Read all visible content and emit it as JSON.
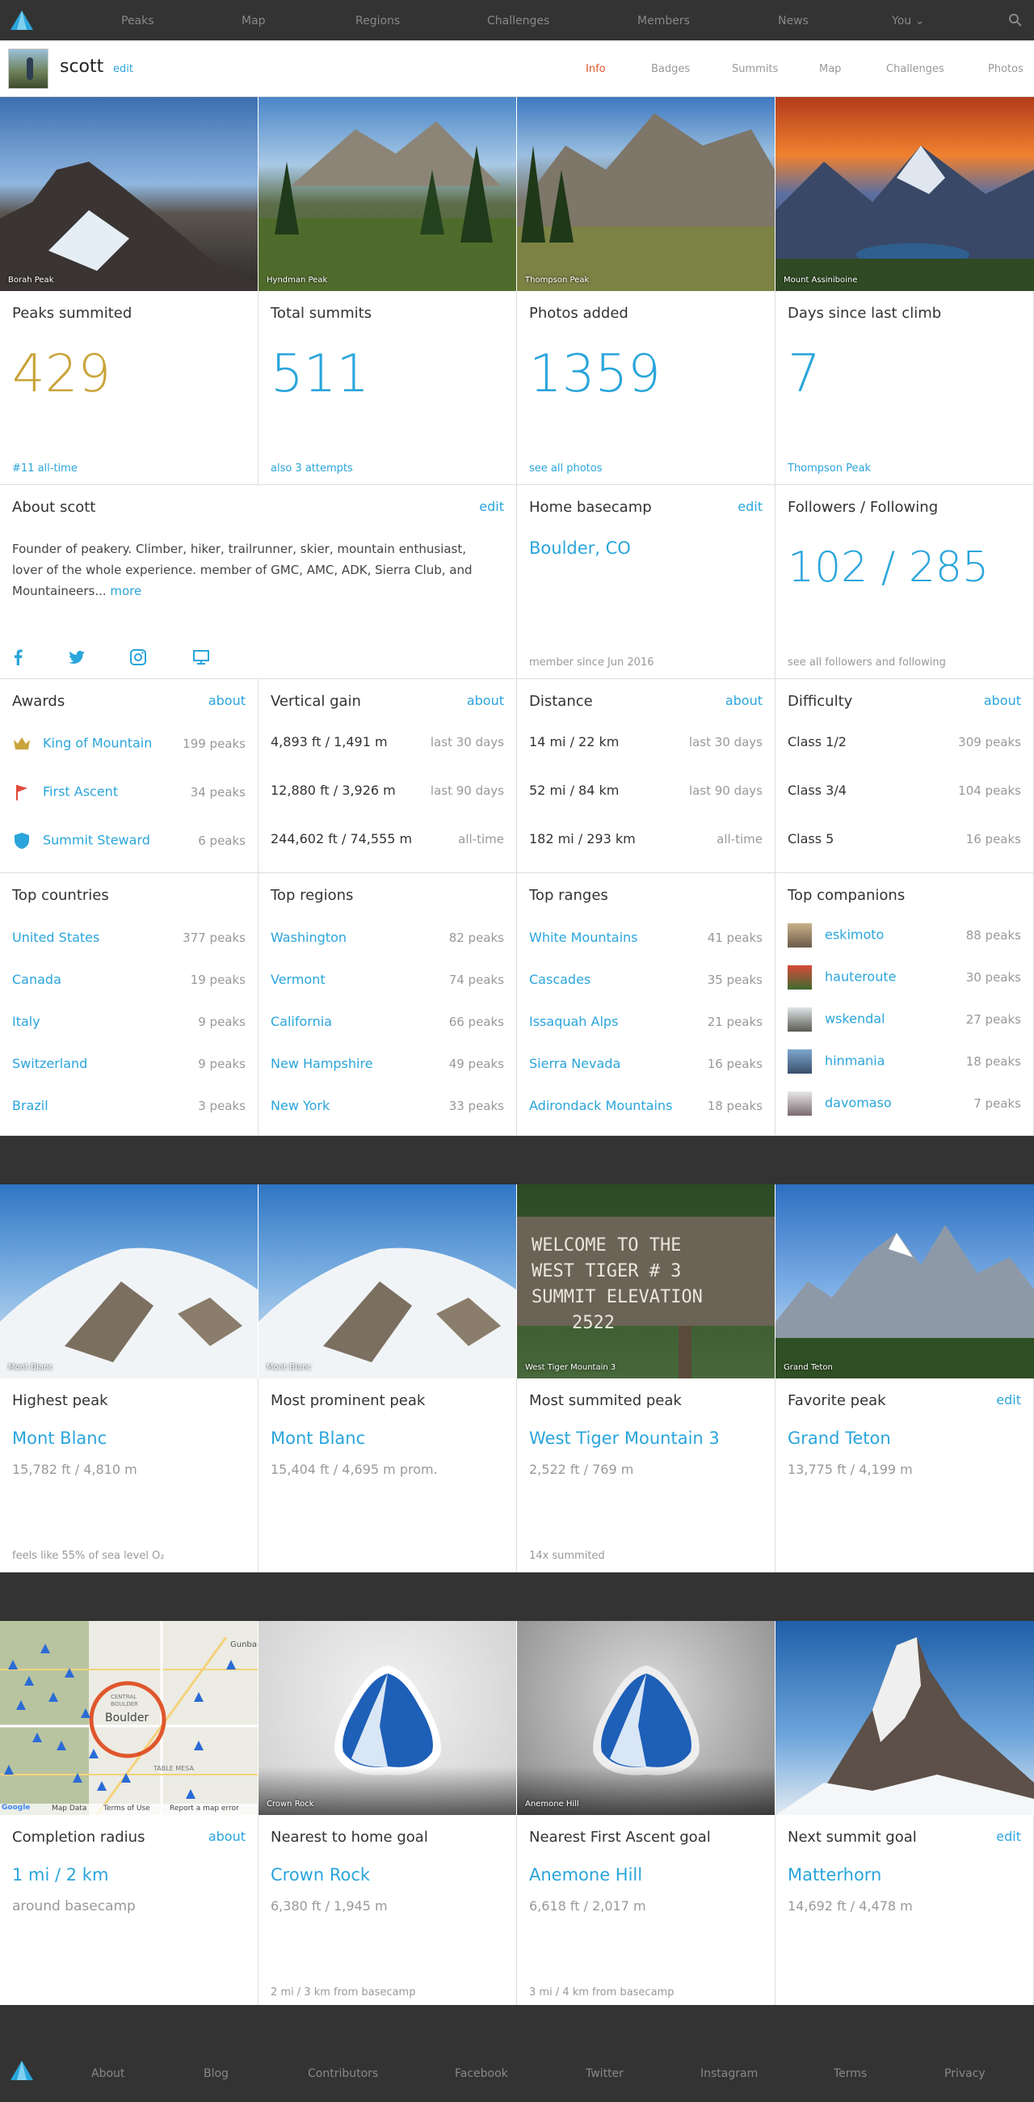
{
  "nav": {
    "items": [
      "Peaks",
      "Map",
      "Regions",
      "Challenges",
      "Members",
      "News",
      "You ⌄"
    ]
  },
  "profile": {
    "username": "scott",
    "edit": "edit",
    "tabs": [
      "Info",
      "Badges",
      "Summits",
      "Map",
      "Challenges",
      "Photos"
    ]
  },
  "photos_top": [
    "Borah Peak",
    "Hyndman Peak",
    "Thompson Peak",
    "Mount Assiniboine"
  ],
  "stats": [
    {
      "title": "Peaks summited",
      "value": "429",
      "foot": "#11 all-time",
      "color": "#c9a43a"
    },
    {
      "title": "Total summits",
      "value": "511",
      "foot": "also 3 attempts",
      "color": "#2aa5db"
    },
    {
      "title": "Photos added",
      "value": "1359",
      "foot": "see all photos",
      "color": "#2aa5db"
    },
    {
      "title": "Days since last climb",
      "value": "7",
      "foot": "Thompson Peak",
      "color": "#2aa5db"
    }
  ],
  "about": {
    "title": "About scott",
    "edit": "edit",
    "text": "Founder of peakery. Climber, hiker, trailrunner, skier, mountain enthusiast, lover of the whole experience. member of GMC, AMC, ADK, Sierra Club, and Mountaineers...",
    "more": "more"
  },
  "basecamp": {
    "title": "Home basecamp",
    "edit": "edit",
    "place": "Boulder, CO",
    "since": "member since Jun 2016"
  },
  "followers": {
    "title": "Followers / Following",
    "value": "102 / 285",
    "foot": "see all followers and following"
  },
  "awards": {
    "title": "Awards",
    "about": "about",
    "items": [
      {
        "name": "King of Mountain",
        "count": "199 peaks",
        "icon": "crown-icon"
      },
      {
        "name": "First Ascent",
        "count": "34 peaks",
        "icon": "flag-icon"
      },
      {
        "name": "Summit Steward",
        "count": "6 peaks",
        "icon": "shield-icon"
      }
    ]
  },
  "vertical": {
    "title": "Vertical gain",
    "about": "about",
    "items": [
      {
        "value": "4,893 ft / 1,491 m",
        "period": "last 30 days"
      },
      {
        "value": "12,880 ft / 3,926 m",
        "period": "last 90 days"
      },
      {
        "value": "244,602 ft / 74,555 m",
        "period": "all-time"
      }
    ]
  },
  "distance": {
    "title": "Distance",
    "about": "about",
    "items": [
      {
        "value": "14 mi / 22 km",
        "period": "last 30 days"
      },
      {
        "value": "52 mi / 84 km",
        "period": "last 90 days"
      },
      {
        "value": "182 mi / 293 km",
        "period": "all-time"
      }
    ]
  },
  "difficulty": {
    "title": "Difficulty",
    "about": "about",
    "items": [
      {
        "value": "Class 1/2",
        "count": "309 peaks"
      },
      {
        "value": "Class 3/4",
        "count": "104 peaks"
      },
      {
        "value": "Class 5",
        "count": "16 peaks"
      }
    ]
  },
  "countries": {
    "title": "Top countries",
    "items": [
      {
        "name": "United States",
        "count": "377 peaks"
      },
      {
        "name": "Canada",
        "count": "19 peaks"
      },
      {
        "name": "Italy",
        "count": "9 peaks"
      },
      {
        "name": "Switzerland",
        "count": "9 peaks"
      },
      {
        "name": "Brazil",
        "count": "3 peaks"
      }
    ]
  },
  "regions": {
    "title": "Top regions",
    "items": [
      {
        "name": "Washington",
        "count": "82 peaks"
      },
      {
        "name": "Vermont",
        "count": "74 peaks"
      },
      {
        "name": "California",
        "count": "66 peaks"
      },
      {
        "name": "New Hampshire",
        "count": "49 peaks"
      },
      {
        "name": "New York",
        "count": "33 peaks"
      }
    ]
  },
  "ranges": {
    "title": "Top ranges",
    "items": [
      {
        "name": "White Mountains",
        "count": "41 peaks"
      },
      {
        "name": "Cascades",
        "count": "35 peaks"
      },
      {
        "name": "Issaquah Alps",
        "count": "21 peaks"
      },
      {
        "name": "Sierra Nevada",
        "count": "16 peaks"
      },
      {
        "name": "Adirondack Mountains",
        "count": "18 peaks"
      }
    ]
  },
  "companions": {
    "title": "Top companions",
    "items": [
      {
        "name": "eskimoto",
        "count": "88 peaks"
      },
      {
        "name": "hauteroute",
        "count": "30 peaks"
      },
      {
        "name": "wskendal",
        "count": "27 peaks"
      },
      {
        "name": "hinmania",
        "count": "18 peaks"
      },
      {
        "name": "davomaso",
        "count": "7 peaks"
      }
    ]
  },
  "photos_mid": [
    "Mont Blanc",
    "Mont Blanc",
    "West Tiger Mountain 3",
    "Grand Teton"
  ],
  "sign_text": [
    "WELCOME TO THE",
    "WEST TIGER # 3",
    "SUMMIT ELEVATION",
    "2522"
  ],
  "peaks": [
    {
      "title": "Highest peak",
      "name": "Mont Blanc",
      "elev": "15,782 ft / 4,810 m",
      "foot": "feels like 55% of sea level O₂",
      "edit": ""
    },
    {
      "title": "Most prominent peak",
      "name": "Mont Blanc",
      "elev": "15,404 ft / 4,695 m prom.",
      "foot": "",
      "edit": ""
    },
    {
      "title": "Most summited peak",
      "name": "West Tiger Mountain 3",
      "elev": "2,522 ft / 769 m",
      "foot": "14x summited",
      "edit": ""
    },
    {
      "title": "Favorite peak",
      "name": "Grand Teton",
      "elev": "13,775 ft / 4,199 m",
      "foot": "",
      "edit": "edit"
    }
  ],
  "map": {
    "city": "Boulder",
    "labels": [
      "Gunbarrel",
      "CENTRAL BOULDER",
      "TABLE MESA",
      "Map Data",
      "Terms of Use",
      "Report a map error",
      "Google"
    ]
  },
  "photos_bot": [
    "",
    "Crown Rock",
    "Anemone Hill",
    ""
  ],
  "goals": [
    {
      "title": "Completion radius",
      "name": "1 mi / 2 km",
      "elev": "around basecamp",
      "foot": "",
      "edit": "about"
    },
    {
      "title": "Nearest to home goal",
      "name": "Crown Rock",
      "elev": "6,380 ft / 1,945 m",
      "foot": "2 mi / 3 km from basecamp",
      "edit": ""
    },
    {
      "title": "Nearest First Ascent goal",
      "name": "Anemone Hill",
      "elev": "6,618 ft / 2,017 m",
      "foot": "3 mi / 4 km from basecamp",
      "edit": ""
    },
    {
      "title": "Next summit goal",
      "name": "Matterhorn",
      "elev": "14,692 ft / 4,478 m",
      "foot": "",
      "edit": "edit"
    }
  ],
  "footer": {
    "items": [
      "About",
      "Blog",
      "Contributors",
      "Facebook",
      "Twitter",
      "Instagram",
      "Terms",
      "Privacy"
    ]
  },
  "colors": {
    "accent": "#2aa5db",
    "gold": "#c9a43a",
    "active_tab": "#e0562c",
    "dark": "#333333"
  }
}
